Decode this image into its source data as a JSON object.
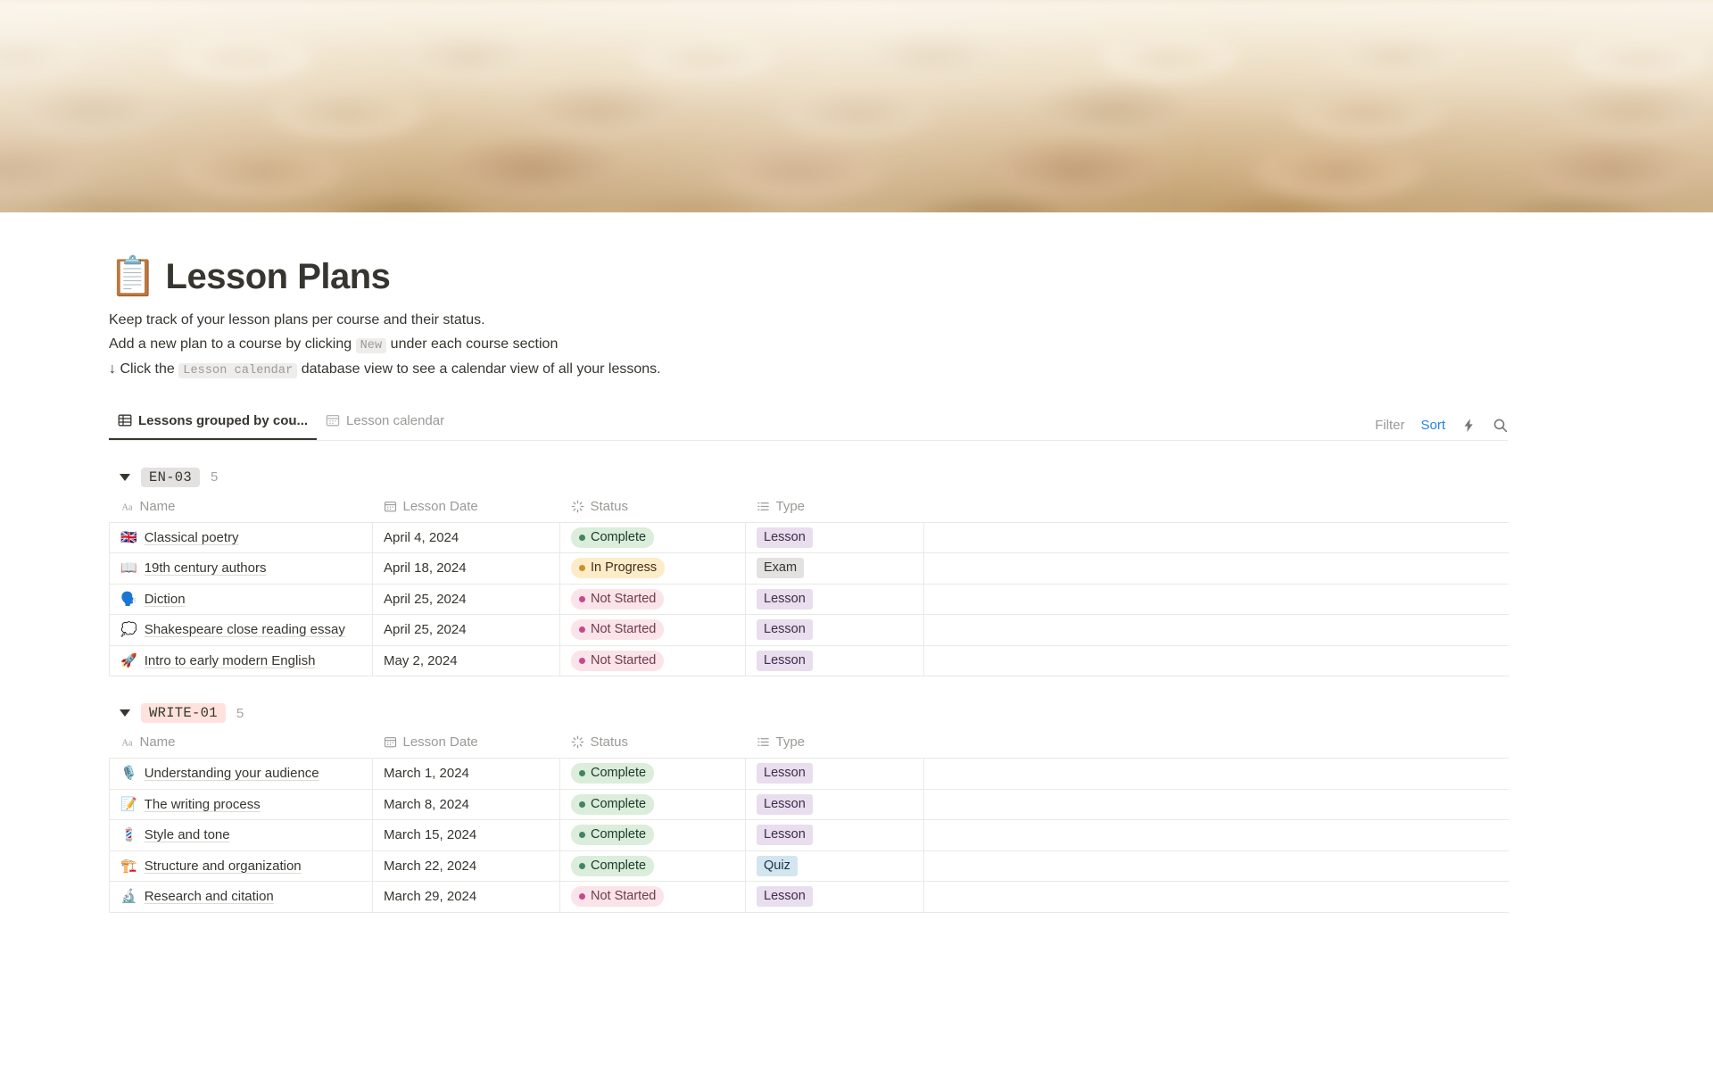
{
  "cover": {
    "alt": "blurred wooden auditorium seats"
  },
  "page": {
    "emoji": "📋",
    "title": "Lesson Plans",
    "description": {
      "line1": "Keep track of your lesson plans per course and their status.",
      "line2_a": "Add a new plan to a course by clicking ",
      "line2_code": "New",
      "line2_b": " under each course section",
      "line3_a": "↓ Click the ",
      "line3_code": "Lesson calendar",
      "line3_b": " database view to see a calendar view of all your lessons."
    }
  },
  "views": {
    "tabs": [
      {
        "label": "Lessons grouped by cou...",
        "icon": "table-icon",
        "active": true
      },
      {
        "label": "Lesson calendar",
        "icon": "calendar-icon",
        "active": false
      }
    ],
    "tools": {
      "filter_label": "Filter",
      "sort_label": "Sort",
      "automation_icon": "lightning-icon",
      "search_icon": "search-icon",
      "accent_color": "#2382e2"
    }
  },
  "columns": [
    {
      "label": "Name",
      "icon": "text-aa-icon"
    },
    {
      "label": "Lesson Date",
      "icon": "calendar-icon"
    },
    {
      "label": "Status",
      "icon": "status-spinner-icon"
    },
    {
      "label": "Type",
      "icon": "select-list-icon"
    }
  ],
  "status_colors": {
    "Complete": {
      "bg": "#dbeddb",
      "fg": "#1c3829",
      "dot": "#448361"
    },
    "In Progress": {
      "bg": "#fdecc8",
      "fg": "#402c1b",
      "dot": "#cb912f"
    },
    "Not Started": {
      "bg": "#fbe4e9",
      "fg": "#6e3b50",
      "dot": "#c14c8a"
    }
  },
  "type_colors": {
    "Lesson": {
      "bg": "#e8deee",
      "fg": "#402c4b"
    },
    "Exam": {
      "bg": "#e3e2e0",
      "fg": "#37352f"
    },
    "Quiz": {
      "bg": "#d3e5ef",
      "fg": "#183347"
    }
  },
  "groups": [
    {
      "name": "EN-03",
      "count": "5",
      "pill_bg": "#e3e2e0",
      "rows": [
        {
          "emoji": "🇬🇧",
          "name": "Classical poetry",
          "date": "April 4, 2024",
          "status": "Complete",
          "type": "Lesson"
        },
        {
          "emoji": "📖",
          "name": "19th century authors",
          "date": "April 18, 2024",
          "status": "In Progress",
          "type": "Exam"
        },
        {
          "emoji": "🗣️",
          "name": "Diction",
          "date": "April 25, 2024",
          "status": "Not Started",
          "type": "Lesson"
        },
        {
          "emoji": "💭",
          "name": "Shakespeare close reading essay",
          "date": "April 25, 2024",
          "status": "Not Started",
          "type": "Lesson"
        },
        {
          "emoji": "🚀",
          "name": "Intro to early modern English",
          "date": "May 2, 2024",
          "status": "Not Started",
          "type": "Lesson"
        }
      ]
    },
    {
      "name": "WRITE-01",
      "count": "5",
      "pill_bg": "#ffe2dd",
      "rows": [
        {
          "emoji": "🎙️",
          "name": "Understanding your audience",
          "date": "March 1, 2024",
          "status": "Complete",
          "type": "Lesson"
        },
        {
          "emoji": "📝",
          "name": "The writing process",
          "date": "March 8, 2024",
          "status": "Complete",
          "type": "Lesson"
        },
        {
          "emoji": "💈",
          "name": "Style and tone",
          "date": "March 15, 2024",
          "status": "Complete",
          "type": "Lesson"
        },
        {
          "emoji": "🏗️",
          "name": "Structure and organization",
          "date": "March 22, 2024",
          "status": "Complete",
          "type": "Quiz"
        },
        {
          "emoji": "🔬",
          "name": "Research and citation",
          "date": "March 29, 2024",
          "status": "Not Started",
          "type": "Lesson"
        }
      ]
    }
  ]
}
